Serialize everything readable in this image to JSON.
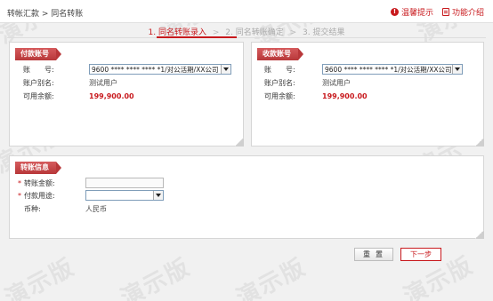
{
  "breadcrumb": "转帐汇款 > 同名转账",
  "topbar": {
    "tips_label": "温馨提示",
    "intro_label": "功能介绍"
  },
  "steps": [
    {
      "label": "1. 同名转账录入",
      "active": true
    },
    {
      "label": "2. 同名转账确定",
      "active": false
    },
    {
      "label": "3. 提交结果",
      "active": false
    }
  ],
  "pay_panel": {
    "title": "付款账号",
    "account_label": "账　　号:",
    "account_value": "9600 **** **** **** *1/对公活期/XX公司",
    "alias_label": "账户别名:",
    "alias_value": "测试用户",
    "balance_label": "可用余额:",
    "balance_value": "199,900.00"
  },
  "recv_panel": {
    "title": "收款账号",
    "account_label": "账　　号:",
    "account_value": "9600 **** **** **** *1/对公活期/XX公司",
    "alias_label": "账户别名:",
    "alias_value": "测试用户",
    "balance_label": "可用余额:",
    "balance_value": "199,900.00"
  },
  "transfer_panel": {
    "title": "转账信息",
    "amount_label": "转账金额:",
    "amount_value": "",
    "purpose_label": "付款用途:",
    "purpose_value": "",
    "currency_label": "币种:",
    "currency_value": "人民币"
  },
  "buttons": {
    "reset_label": "重置",
    "next_label": "下一步"
  },
  "watermark_text": "演示版",
  "colors": {
    "accent": "#c8191d",
    "panel_header": "#c0474a",
    "background": "#f1f1f1"
  }
}
